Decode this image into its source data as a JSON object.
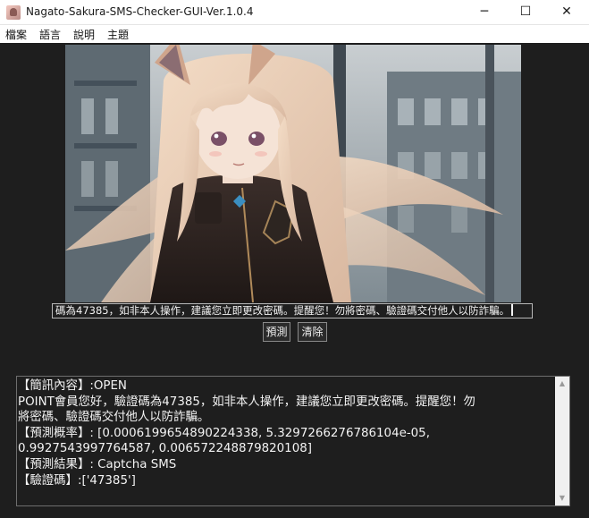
{
  "window": {
    "title": "Nagato-Sakura-SMS-Checker-GUI-Ver.1.0.4",
    "icon": "app-avatar-icon",
    "controls": {
      "minimize": "─",
      "maximize": "☐",
      "close": "✕"
    }
  },
  "menu": {
    "items": [
      "檔案",
      "語言",
      "說明",
      "主題"
    ]
  },
  "image": {
    "description_icon": "anime-girl-illustration"
  },
  "input": {
    "value": "碼為47385，如非本人操作，建議您立即更改密碼。提醒您！勿將密碼、驗證碼交付他人以防詐騙。"
  },
  "buttons": {
    "predict": "預測",
    "clear": "清除"
  },
  "output": {
    "lines": [
      "【簡訊內容】:OPEN",
      "POINT會員您好，驗證碼為47385，如非本人操作，建議您立即更改密碼。提醒您！勿",
      "將密碼、驗證碼交付他人以防詐騙。",
      "【預測概率】: [0.0006199654890224338, 5.3297266276786104e-05,",
      "0.9927543997764587, 0.006572248879820108]",
      "【預測結果】: Captcha SMS",
      "【驗證碼】:['47385']"
    ]
  },
  "colors": {
    "background": "#1e1e1e",
    "text": "#f3f3f3",
    "titlebar": "#ffffff"
  }
}
